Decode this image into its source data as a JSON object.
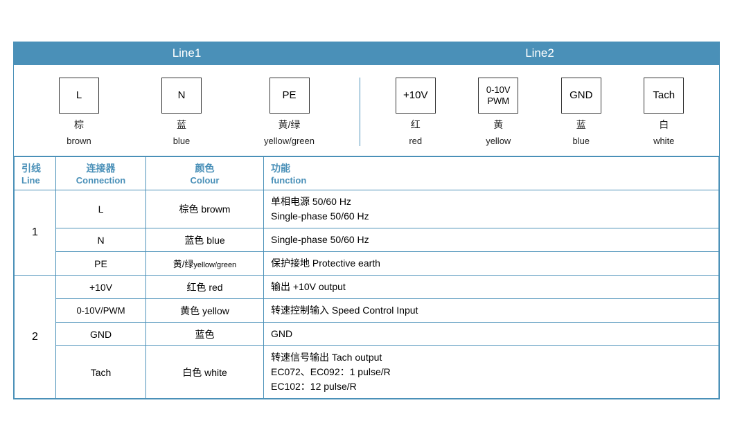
{
  "header": {
    "line1": "Line1",
    "line2": "Line2"
  },
  "diagram": {
    "line1_connectors": [
      {
        "label": "L",
        "zh": "棕",
        "en": "brown"
      },
      {
        "label": "N",
        "zh": "蓝",
        "en": "blue"
      },
      {
        "label": "PE",
        "zh": "黄/绿",
        "en": "yellow/green"
      }
    ],
    "line2_connectors": [
      {
        "label": "+10V",
        "zh": "红",
        "en": "red"
      },
      {
        "label": "0-10V\nPWM",
        "zh": "黄",
        "en": "yellow"
      },
      {
        "label": "GND",
        "zh": "蓝",
        "en": "blue"
      },
      {
        "label": "Tach",
        "zh": "白",
        "en": "white"
      }
    ]
  },
  "table": {
    "headers": {
      "line_zh": "引线",
      "line_en": "Line",
      "connection_zh": "连接器",
      "connection_en": "Connection",
      "colour_zh": "颜色",
      "colour_en": "Colour",
      "function_zh": "功能",
      "function_en": "function"
    },
    "rows_line1": [
      {
        "connection": "L",
        "colour_zh": "棕色",
        "colour_en": "browm",
        "function": "单相电源 50/60 Hz\nSingle-phase 50/60 Hz",
        "rowspan": false
      },
      {
        "connection": "N",
        "colour_zh": "蓝色",
        "colour_en": "blue",
        "function": "Single-phase 50/60 Hz",
        "rowspan": false
      },
      {
        "connection": "PE",
        "colour_zh": "黄/绿",
        "colour_en": "yellow/green",
        "function": "保护接地 Protective earth",
        "rowspan": false
      }
    ],
    "rows_line2": [
      {
        "connection": "+10V",
        "colour_zh": "红色",
        "colour_en": "red",
        "function": "输出 +10V output"
      },
      {
        "connection": "0-10V/PWM",
        "colour_zh": "黄色",
        "colour_en": "yellow",
        "function": "转速控制输入 Speed Control Input"
      },
      {
        "connection": "GND",
        "colour_zh": "蓝色",
        "colour_en": "",
        "function": "GND"
      },
      {
        "connection": "Tach",
        "colour_zh": "白色",
        "colour_en": "white",
        "function": "转速信号输出 Tach output\nEC072、EC092：1 pulse/R\nEC102：12 pulse/R"
      }
    ]
  }
}
